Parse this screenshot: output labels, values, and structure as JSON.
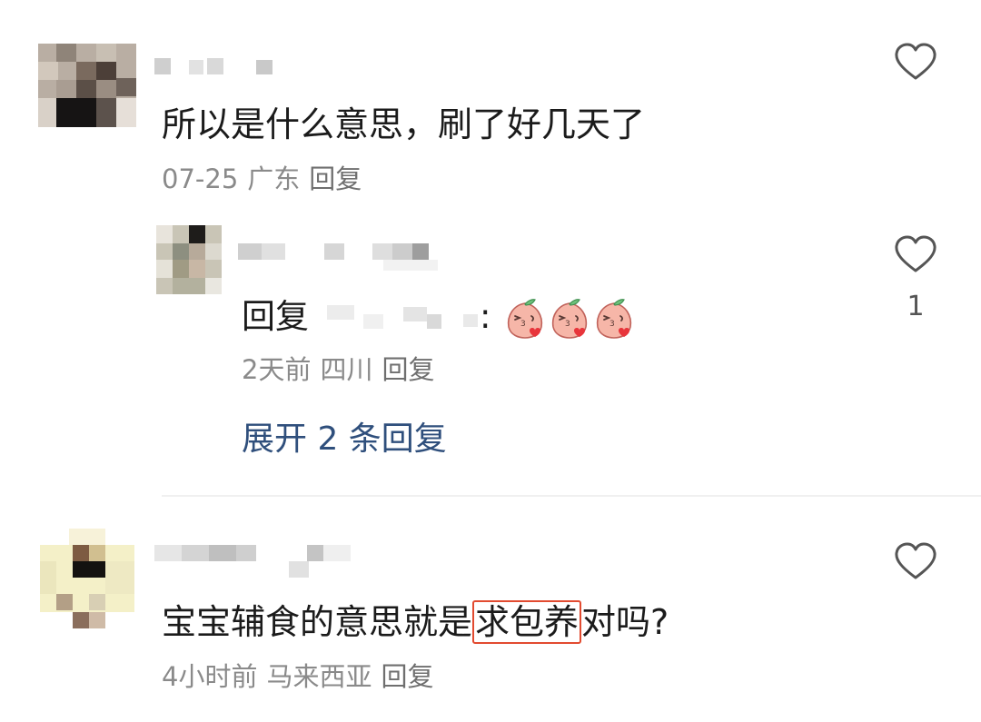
{
  "comment1": {
    "text": "所以是什么意思，刷了好几天了",
    "date": "07-25",
    "location": "广东",
    "reply_label": "回复"
  },
  "reply1": {
    "prefix": "回复",
    "colon": ":",
    "emoji": [
      "peach-kiss",
      "peach-kiss",
      "peach-kiss"
    ],
    "date": "2天前",
    "location": "四川",
    "reply_label": "回复",
    "like_count": "1"
  },
  "expand": {
    "label": "展开 2 条回复"
  },
  "comment2": {
    "text_before": "宝宝辅食的意思就是",
    "text_highlight": "求包养",
    "text_after": "对吗?",
    "date": "4小时前",
    "location": "马来西亚",
    "reply_label": "回复"
  },
  "colors": {
    "highlight_border": "#e24b30",
    "expand_link": "#2f4f7c",
    "meta_text": "#8a8a8a"
  }
}
